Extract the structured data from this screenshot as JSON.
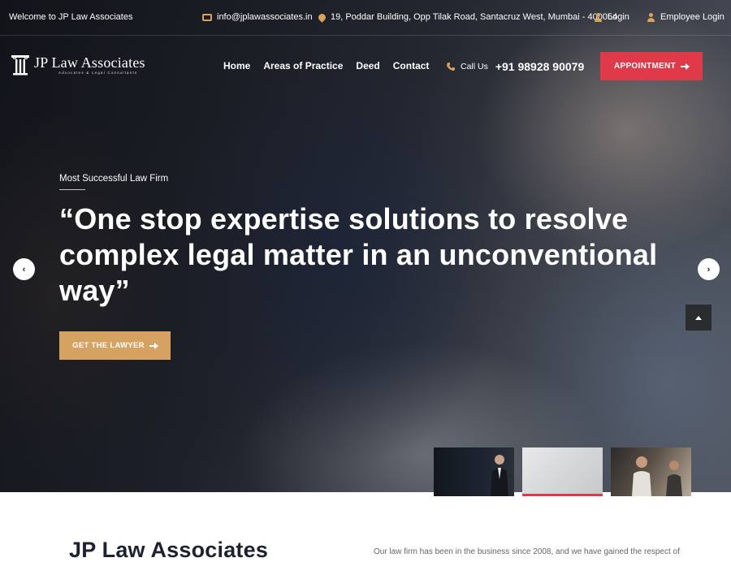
{
  "topbar": {
    "welcome": "Welcome to JP Law Associates",
    "email": "info@jplawassociates.in",
    "address": "19, Poddar Building, Opp Tilak Road, Santacruz West, Mumbai - 400054",
    "login": "Login",
    "employee_login": "Employee Login"
  },
  "logo": {
    "title": "JP Law Associates",
    "subtitle": "Advocates & Legal Consultants"
  },
  "menu": {
    "items": [
      {
        "label": "Home"
      },
      {
        "label": "Areas of Practice"
      },
      {
        "label": "Deed"
      },
      {
        "label": "Contact"
      }
    ]
  },
  "call": {
    "label": "Call Us",
    "number": "+91 98928 90079"
  },
  "appointment_label": "APPOINTMENT",
  "hero": {
    "eyebrow": "Most Successful Law Firm",
    "headline": "“One stop expertise solutions to resolve complex legal matter in an unconventional way”",
    "cta_label": "GET THE LAWYER",
    "prev_glyph": "‹",
    "next_glyph": "›",
    "active_slide": 2
  },
  "about": {
    "title": "JP Law Associates",
    "text": "Our law firm has been in the business since 2008, and we have gained the respect of"
  },
  "colors": {
    "accent_red": "#e0394a",
    "accent_gold": "#d6a261",
    "icon_gold": "#d9a35a"
  }
}
